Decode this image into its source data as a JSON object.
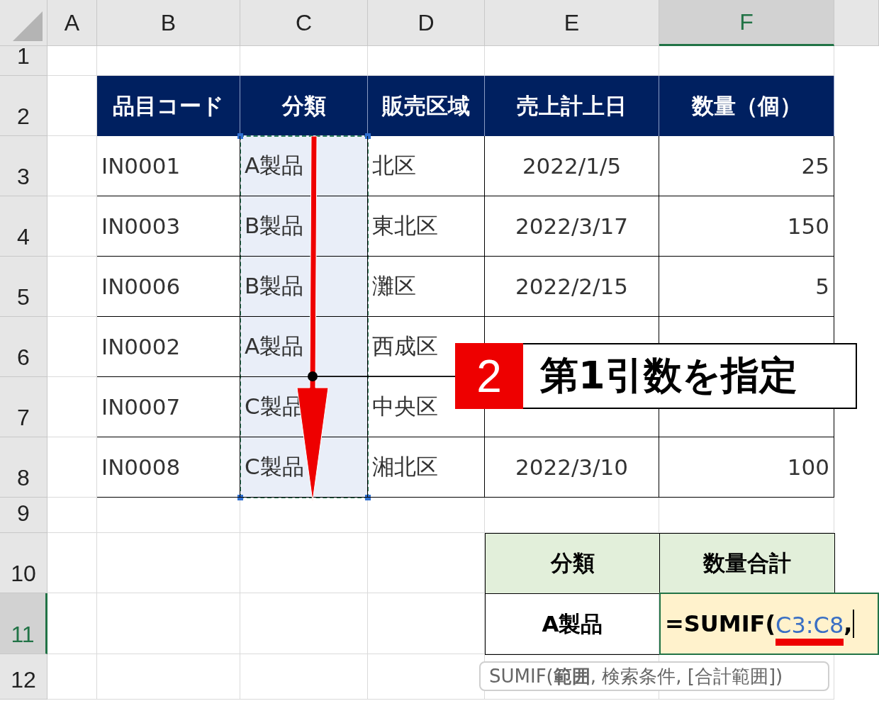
{
  "columns": [
    {
      "label": "A",
      "selected": false
    },
    {
      "label": "B",
      "selected": false
    },
    {
      "label": "C",
      "selected": false
    },
    {
      "label": "D",
      "selected": false
    },
    {
      "label": "E",
      "selected": false
    },
    {
      "label": "F",
      "selected": true
    },
    {
      "selected": false
    }
  ],
  "rows": [
    {
      "label": "1",
      "selected": false
    },
    {
      "label": "2",
      "selected": false
    },
    {
      "label": "3",
      "selected": false
    },
    {
      "label": "4",
      "selected": false
    },
    {
      "label": "5",
      "selected": false
    },
    {
      "label": "6",
      "selected": false
    },
    {
      "label": "7",
      "selected": false
    },
    {
      "label": "8",
      "selected": false
    },
    {
      "label": "9",
      "selected": false
    },
    {
      "label": "10",
      "selected": false
    },
    {
      "label": "11",
      "selected": true
    },
    {
      "label": "12",
      "selected": false
    }
  ],
  "table": {
    "headers": [
      "品目コード",
      "分類",
      "販売区域",
      "売上計上日",
      "数量（個）"
    ],
    "rows": [
      {
        "code": "IN0001",
        "category": "A製品",
        "region": "北区",
        "date": "2022/1/5",
        "quantity": "25"
      },
      {
        "code": "IN0003",
        "category": "B製品",
        "region": "東北区",
        "date": "2022/3/17",
        "quantity": "150"
      },
      {
        "code": "IN0006",
        "category": "B製品",
        "region": "灘区",
        "date": "2022/2/15",
        "quantity": "5"
      },
      {
        "code": "IN0002",
        "category": "A製品",
        "region": "西成区"
      },
      {
        "code": "IN0007",
        "category": "C製品",
        "region": "中央区"
      },
      {
        "code": "IN0008",
        "category": "C製品",
        "region": "湘北区",
        "date": "2022/3/10",
        "quantity": "100"
      }
    ]
  },
  "summary": {
    "headers": [
      "分類",
      "数量合計"
    ],
    "label": "A製品",
    "formula": {
      "prefix": "=SUMIF(",
      "reference": "C3:C8",
      "suffix": ","
    }
  },
  "tooltip": "SUMIF(**範囲**, 検索条件, [合計範囲])",
  "callout": {
    "number": "2",
    "text": "第1引数を指定"
  }
}
